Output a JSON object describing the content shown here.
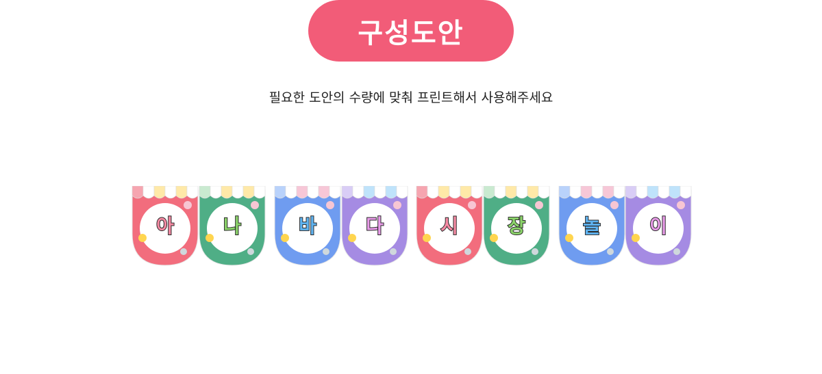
{
  "header": {
    "title": "구성도안",
    "subtitle": "필요한 도안의 수량에 맞춰 프린트해서 사용해주세요"
  },
  "flags": [
    {
      "letter": "아",
      "theme": "red"
    },
    {
      "letter": "나",
      "theme": "green"
    },
    {
      "letter": "바",
      "theme": "blue"
    },
    {
      "letter": "다",
      "theme": "purple"
    },
    {
      "letter": "시",
      "theme": "red"
    },
    {
      "letter": "장",
      "theme": "green"
    },
    {
      "letter": "놀",
      "theme": "blue"
    },
    {
      "letter": "이",
      "theme": "purple"
    }
  ],
  "colors": {
    "title_pill": "#f25c78",
    "red": "#f26d7d",
    "green": "#4fae86",
    "blue": "#6f9cf0",
    "purple": "#a58be3",
    "letter_red": "#f58aa3",
    "letter_green": "#8bd36a",
    "letter_blue": "#5fb3f0",
    "letter_purple": "#e89be8"
  }
}
